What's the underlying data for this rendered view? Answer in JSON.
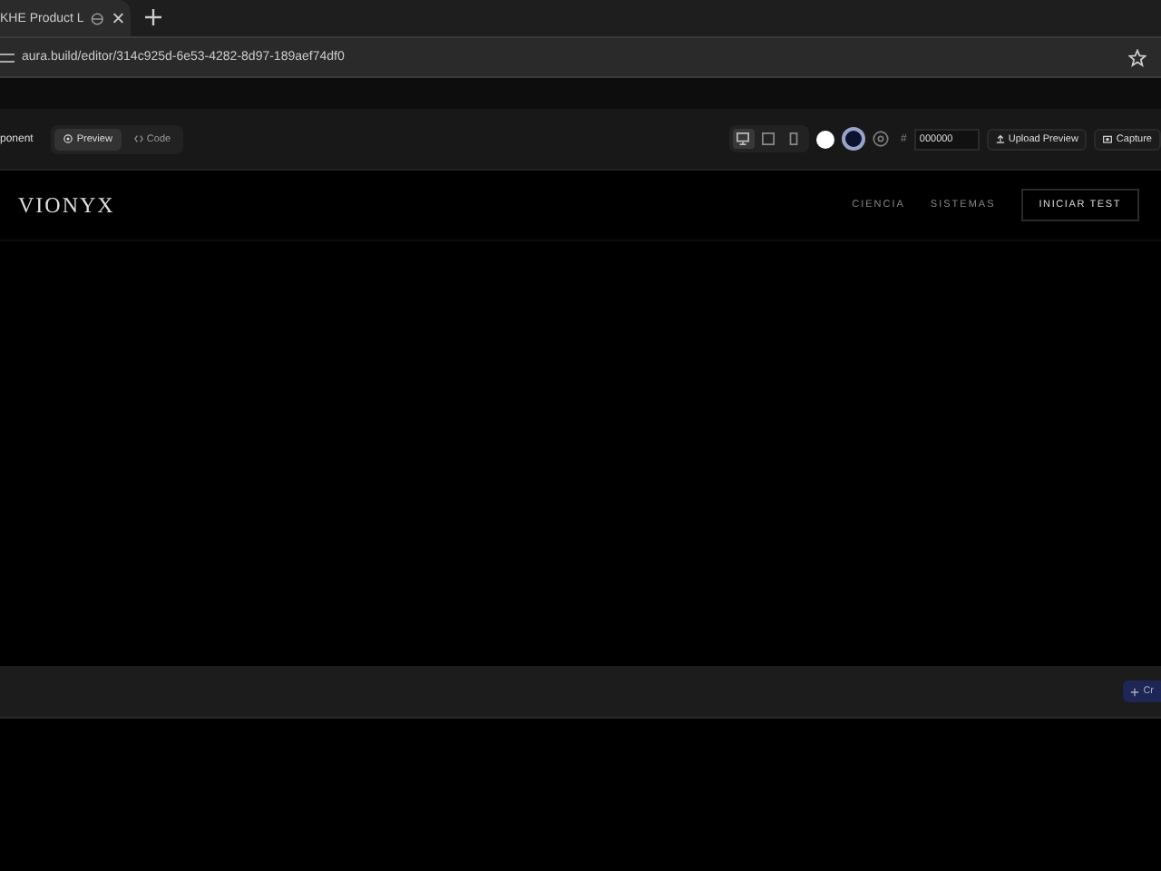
{
  "browser": {
    "tab_title": "KHE Product L",
    "url": "aura.build/editor/314c925d-6e53-4282-8d97-189aef74df0"
  },
  "toolbar": {
    "title": "ponent",
    "view_tabs": [
      {
        "label": "Preview",
        "selected": true
      },
      {
        "label": "Code",
        "selected": false
      }
    ],
    "devices": [
      {
        "kind": "desktop",
        "selected": true
      },
      {
        "kind": "tablet",
        "selected": false
      },
      {
        "kind": "mobile",
        "selected": false
      }
    ],
    "swatches": [
      {
        "color": "#ffffff",
        "selected": false
      },
      {
        "color": "#0b1230",
        "selected": true
      }
    ],
    "hex_label": "#",
    "hex_value": "000000",
    "upload": "Upload Preview",
    "capture": "Capture"
  },
  "preview": {
    "logo": "VIONYX",
    "nav": [
      "CIENCIA",
      "SISTEMAS"
    ],
    "cta": "INICIAR TEST"
  },
  "bottom_bar": {
    "button": "Cr"
  }
}
